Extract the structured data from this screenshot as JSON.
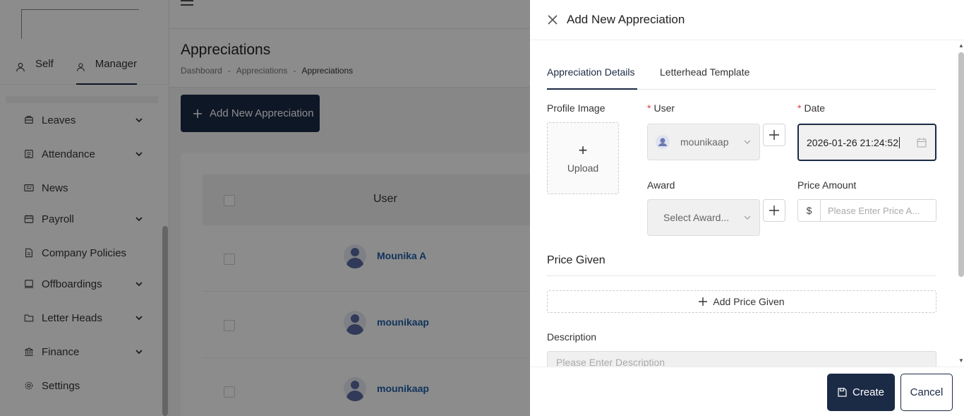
{
  "sidebar": {
    "roles": [
      {
        "label": "Self"
      },
      {
        "label": "Manager",
        "active": true
      }
    ],
    "items": [
      {
        "label": "Leaves",
        "icon": "leave-icon",
        "has_submenu": true
      },
      {
        "label": "Attendance",
        "icon": "attendance-icon",
        "has_submenu": true
      },
      {
        "label": "News",
        "icon": "news-icon",
        "has_submenu": false
      },
      {
        "label": "Payroll",
        "icon": "payroll-icon",
        "has_submenu": true
      },
      {
        "label": "Company Policies",
        "icon": "document-icon",
        "has_submenu": false
      },
      {
        "label": "Offboardings",
        "icon": "offboarding-icon",
        "has_submenu": true
      },
      {
        "label": "Letter Heads",
        "icon": "folder-icon",
        "has_submenu": true
      },
      {
        "label": "Finance",
        "icon": "bank-icon",
        "has_submenu": true
      },
      {
        "label": "Settings",
        "icon": "gear-icon",
        "has_submenu": false
      }
    ]
  },
  "page": {
    "title": "Appreciations",
    "breadcrumb": [
      "Dashboard",
      "Appreciations",
      "Appreciations"
    ],
    "add_button": "Add New Appreciation",
    "table": {
      "header_user": "User",
      "rows": [
        {
          "name": "Mounika A"
        },
        {
          "name": "mounikaap"
        },
        {
          "name": "mounikaap"
        }
      ]
    }
  },
  "drawer": {
    "title": "Add New Appreciation",
    "tabs": [
      "Appreciation Details",
      "Letterhead Template"
    ],
    "profile_image_label": "Profile Image",
    "upload_label": "Upload",
    "user_label": "User",
    "user_value": "mounikaap",
    "date_label": "Date",
    "date_value": "2026-01-26 21:24:52",
    "award_label": "Award",
    "award_placeholder": "Select Award...",
    "price_amount_label": "Price Amount",
    "currency_symbol": "$",
    "price_placeholder": "Please Enter Price A...",
    "price_given_title": "Price Given",
    "add_price_given": "Add Price Given",
    "description_label": "Description",
    "description_placeholder": "Please Enter Description",
    "create_button": "Create",
    "cancel_button": "Cancel"
  },
  "colors": {
    "primary": "#1b2a45",
    "link": "#1e5fa8",
    "required": "#e0393e"
  }
}
